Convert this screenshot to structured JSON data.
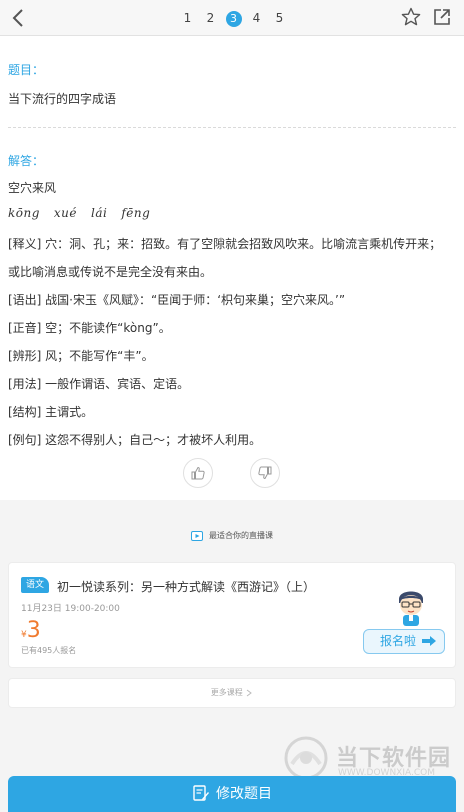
{
  "pager": {
    "pages": [
      "1",
      "2",
      "3",
      "4",
      "5"
    ],
    "current": "3"
  },
  "question": {
    "label": "题目：",
    "text": "当下流行的四字成语"
  },
  "answer": {
    "label": "解答：",
    "idiom": "空穴来风",
    "pinyin": [
      "kōng",
      "xué",
      "lái",
      "fēng"
    ],
    "lines": [
      "[释义] 穴：洞、孔；来：招致。有了空隙就会招致风吹来。比喻流言乘机传开来；",
      "或比喻消息或传说不是完全没有来由。",
      "[语出] 战国·宋玉《风赋》：“臣闻于师：‘枳句来巢；空穴来风。’”",
      "[正音] 空；不能读作“kòng”。",
      "[辨形] 风；不能写作“丰”。",
      "[用法] 一般作谓语、宾语、定语。",
      "[结构] 主谓式。",
      "[例句] 这怨不得别人；自己～；才被坏人利用。"
    ]
  },
  "live": {
    "header": "最适合你的直播课"
  },
  "course": {
    "subject": "语文",
    "title": "初一悦读系列：另一种方式解读《西游记》（上）",
    "time": "11月23日 19:00-20:00",
    "currency": "¥",
    "price": "3",
    "enrolled": "已有495人报名",
    "signup": "报名啦"
  },
  "more_courses": "更多课程",
  "watermark": {
    "name": "当下软件园",
    "url": "WWW.DOWNXIA.COM"
  },
  "bottom_button": "修改题目",
  "colors": {
    "accent": "#2ea6e3",
    "price": "#f07a2e"
  }
}
